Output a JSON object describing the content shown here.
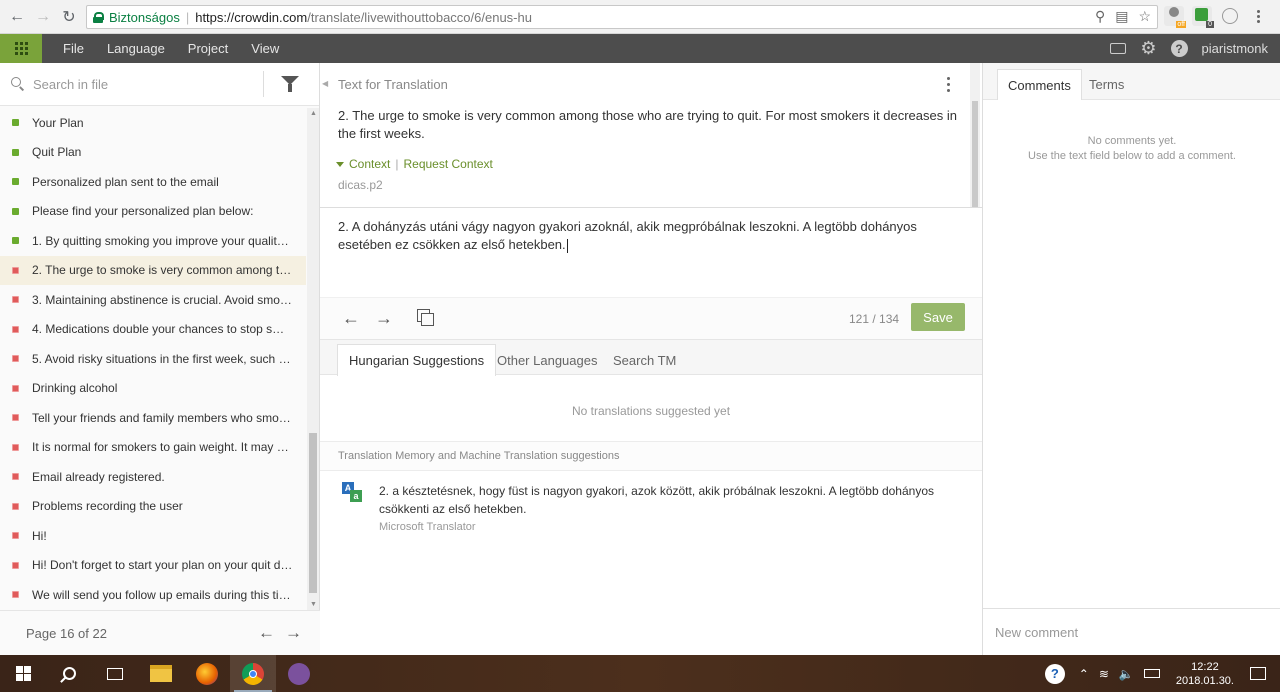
{
  "browser": {
    "secure_label": "Biztonságos",
    "url_host": "https://crowdin.com",
    "url_path": "/translate/livewithouttobacco/6/enus-hu",
    "ext_off_badge": "off",
    "ext_count_badge": "0"
  },
  "app_menu": {
    "items": [
      "File",
      "Language",
      "Project",
      "View"
    ],
    "username": "piaristmonk",
    "help_glyph": "?"
  },
  "left_panel": {
    "search_placeholder": "Search in file",
    "strings": [
      {
        "text": "Your Plan",
        "status": "translated"
      },
      {
        "text": "Quit Plan",
        "status": "translated"
      },
      {
        "text": "Personalized plan sent to the email",
        "status": "translated"
      },
      {
        "text": "Please find your personalized plan below:",
        "status": "translated"
      },
      {
        "text": "1. By quitting smoking you improve your quality o...",
        "status": "translated"
      },
      {
        "text": "2. The urge to smoke is very common among tho...",
        "status": "untranslated",
        "active": true
      },
      {
        "text": "3. Maintaining abstinence is crucial. Avoid smokin...",
        "status": "untranslated"
      },
      {
        "text": "4. Medications double your chances to stop smok...",
        "status": "untranslated"
      },
      {
        "text": "5. Avoid risky situations in the first week, such as:",
        "status": "untranslated"
      },
      {
        "text": "Drinking alcohol",
        "status": "untranslated"
      },
      {
        "text": "Tell your friends and family members who smoke...",
        "status": "untranslated"
      },
      {
        "text": "It is normal for smokers to gain weight. It may be ...",
        "status": "untranslated"
      },
      {
        "text": "Email already registered.",
        "status": "untranslated"
      },
      {
        "text": "Problems recording the user",
        "status": "untranslated"
      },
      {
        "text": "Hi!",
        "status": "untranslated"
      },
      {
        "text": "Hi! Don't forget to start your plan on your quit da...",
        "status": "untranslated"
      },
      {
        "text": "We will send you follow up emails during this time.",
        "status": "untranslated"
      }
    ],
    "pager_text": "Page 16 of 22"
  },
  "center": {
    "source_header": "Text for Translation",
    "source_text": "2. The urge to smoke is very common among those who are trying to quit. For most smokers it decreases in the first weeks.",
    "context_label": "Context",
    "request_context_label": "Request Context",
    "string_key": "dicas.p2",
    "translation_text": "2. A dohányzás utáni vágy nagyon gyakori azoknál, akik megpróbálnak leszokni. A legtöbb dohányos esetében ez csökken az első hetekben.",
    "char_counter": "121 / 134",
    "save_label": "Save",
    "tabs": [
      "Hungarian Suggestions",
      "Other Languages",
      "Search TM"
    ],
    "no_suggestions": "No translations suggested yet",
    "tm_header": "Translation Memory and Machine Translation suggestions",
    "mt_suggestion": "2. a késztetésnek, hogy füst is nagyon gyakori, azok között, akik próbálnak leszokni. A legtöbb dohányos csökkenti az első hetekben.",
    "mt_source": "Microsoft Translator"
  },
  "right_panel": {
    "tabs": [
      "Comments",
      "Terms"
    ],
    "no_comments_line1": "No comments yet.",
    "no_comments_line2": "Use the text field below to add a comment.",
    "comment_placeholder": "New comment"
  },
  "taskbar": {
    "time": "12:22",
    "date": "2018.01.30.",
    "help_glyph": "?"
  },
  "colors": {
    "accent_green": "#7aa33a",
    "translated": "#6aab2e",
    "untranslated": "#e05b5b",
    "save_button": "#97b86b"
  }
}
